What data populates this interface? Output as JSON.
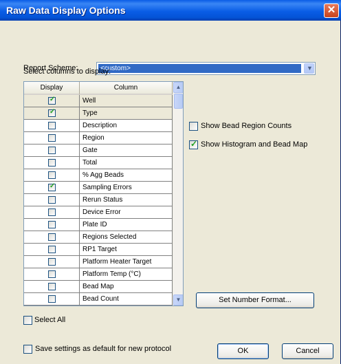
{
  "window": {
    "title": "Raw Data Display Options",
    "close_glyph": "✕"
  },
  "report_scheme": {
    "label": "Report Scheme:",
    "value": "<custom>"
  },
  "columns_section": {
    "label": "Select columns to display:"
  },
  "grid": {
    "headers": {
      "display": "Display",
      "column": "Column"
    },
    "rows": [
      {
        "column": "Well",
        "checked": true
      },
      {
        "column": "Type",
        "checked": true
      },
      {
        "column": "Description",
        "checked": false
      },
      {
        "column": "Region",
        "checked": false
      },
      {
        "column": "Gate",
        "checked": false
      },
      {
        "column": "Total",
        "checked": false
      },
      {
        "column": "% Agg Beads",
        "checked": false
      },
      {
        "column": "Sampling Errors",
        "checked": true
      },
      {
        "column": "Rerun Status",
        "checked": false
      },
      {
        "column": "Device Error",
        "checked": false
      },
      {
        "column": "Plate ID",
        "checked": false
      },
      {
        "column": "Regions Selected",
        "checked": false
      },
      {
        "column": "RP1 Target",
        "checked": false
      },
      {
        "column": "Platform Heater Target",
        "checked": false
      },
      {
        "column": "Platform Temp (°C)",
        "checked": false
      },
      {
        "column": "Bead Map",
        "checked": false
      },
      {
        "column": "Bead Count",
        "checked": false
      }
    ]
  },
  "options": {
    "show_bead_region_counts": {
      "label": "Show Bead Region Counts",
      "checked": false
    },
    "show_histogram": {
      "label": "Show Histogram and Bead Map",
      "checked": true
    }
  },
  "set_number_format": {
    "label": "Set Number Format..."
  },
  "select_all": {
    "label": "Select All",
    "checked": false
  },
  "save_default": {
    "label": "Save settings as default for new protocol",
    "checked": false
  },
  "buttons": {
    "ok": "OK",
    "cancel": "Cancel"
  }
}
